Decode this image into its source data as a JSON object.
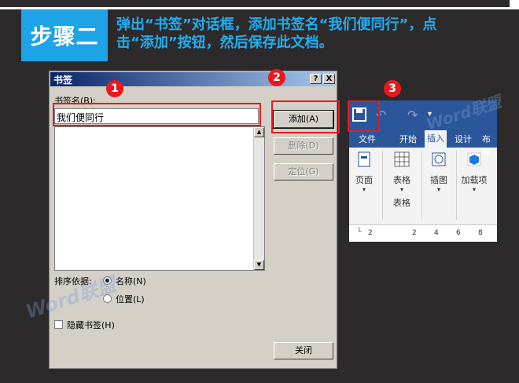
{
  "header": {
    "step_label": "步骤二",
    "instruction_line1": "弹出“书签”对话框，添加书签名“我们便同行”，点",
    "instruction_line2": "击“添加”按钮，然后保存此文档。"
  },
  "dialog": {
    "title": "书签",
    "help_button": "?",
    "close_button": "X",
    "name_label": "书签名(B):",
    "name_value": "我们便同行",
    "add_button": "添加(A)",
    "delete_button": "删除(D)",
    "goto_button": "定位(G)",
    "sort_label": "排序依据:",
    "sort_options": [
      {
        "label": "名称(N)",
        "selected": true
      },
      {
        "label": "位置(L)",
        "selected": false
      }
    ],
    "hidden_checkbox_label": "隐藏书签(H)",
    "close_label": "关闭"
  },
  "callouts": [
    "1",
    "2",
    "3"
  ],
  "ribbon": {
    "tabs": [
      "文件",
      "开始",
      "插入",
      "设计",
      "布局"
    ],
    "active_tab": "插入",
    "groups": [
      {
        "label": "页面"
      },
      {
        "label": "表格",
        "group_caption": "表格"
      },
      {
        "label": "插图"
      },
      {
        "label": "加载项"
      }
    ],
    "ruler_numbers": [
      "2",
      "2",
      "4",
      "6",
      "8"
    ]
  },
  "watermarks": [
    "Word联盟",
    "Word联盟"
  ],
  "colors": {
    "background": "#2c2a2b",
    "accent_blue": "#1ea3e6",
    "callout_red": "#e8191d",
    "word_blue": "#2b579a"
  }
}
